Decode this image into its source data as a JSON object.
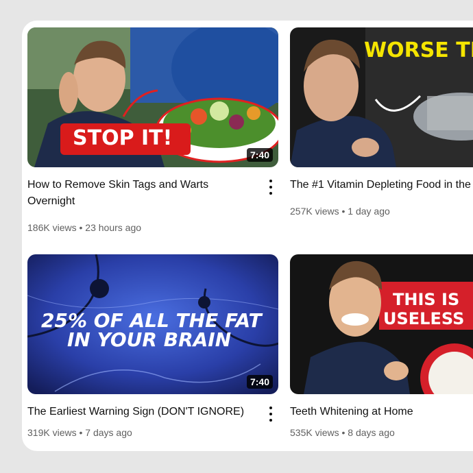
{
  "videos": [
    {
      "title": "How to Remove Skin Tags and Warts Overnight",
      "views": "186K views",
      "age": "23 hours ago",
      "duration": "7:40",
      "thumb_text": "STOP IT!"
    },
    {
      "title": "The #1 Vitamin Depleting Food in the",
      "views": "257K views",
      "age": "1 day ago",
      "duration": "",
      "thumb_text": "WORSE THAN"
    },
    {
      "title": "The Earliest Warning Sign (DON'T IGNORE)",
      "views": "319K views",
      "age": "7 days ago",
      "duration": "7:40",
      "thumb_text_line1": "25% OF ALL THE FAT",
      "thumb_text_line2": "IN YOUR BRAIN"
    },
    {
      "title": "Teeth Whitening at Home",
      "views": "535K views",
      "age": "8 days ago",
      "duration": "",
      "thumb_text_line1": "THIS IS",
      "thumb_text_line2": "USELESS"
    }
  ],
  "separator": "•",
  "icons": {
    "more": "more-vert-icon"
  }
}
